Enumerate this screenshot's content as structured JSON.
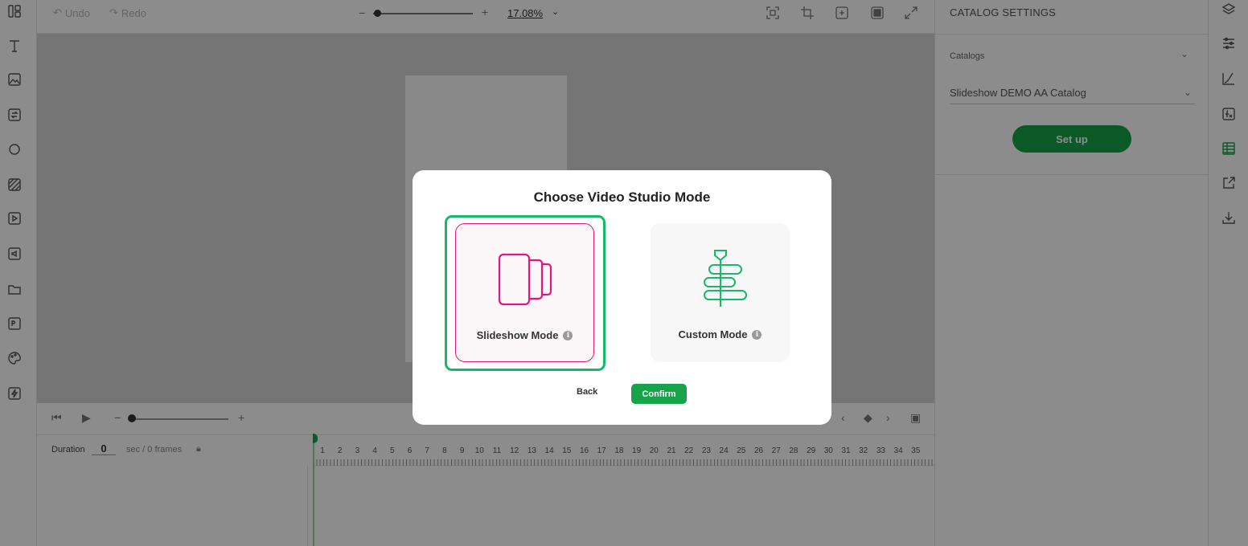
{
  "toolbar": {
    "undo_label": "Undo",
    "redo_label": "Redo",
    "zoom_minus": "−",
    "zoom_plus": "+",
    "zoom_value": "17.08%",
    "zoom_level_fraction": 0.0
  },
  "left_rail": {
    "tools": [
      "layout-icon",
      "text-icon",
      "image-icon",
      "media-swap-icon",
      "shape-icon",
      "pattern-icon",
      "video-icon",
      "audio-icon",
      "folder-icon",
      "photoshop-icon",
      "palette-icon",
      "magic-icon"
    ]
  },
  "timeline": {
    "duration_label": "Duration",
    "duration_value": "0",
    "duration_unit": "sec / 0 frames",
    "zoom_minus": "−",
    "zoom_plus": "+",
    "ruler_numbers": [
      "1",
      "2",
      "3",
      "4",
      "5",
      "6",
      "7",
      "8",
      "9",
      "10",
      "11",
      "12",
      "13",
      "14",
      "15",
      "16",
      "17",
      "18",
      "19",
      "20",
      "21",
      "22",
      "23",
      "24",
      "25",
      "26",
      "27",
      "28",
      "29",
      "30",
      "31",
      "32",
      "33",
      "34",
      "35"
    ]
  },
  "right_panel": {
    "header": "CATALOG SETTINGS",
    "catalogs_label": "Catalogs",
    "catalog_selected": "Slideshow DEMO AA Catalog",
    "setup_label": "Set up"
  },
  "modal": {
    "title": "Choose Video Studio Mode",
    "slideshow_label": "Slideshow Mode",
    "custom_label": "Custom Mode",
    "info_glyph": "i",
    "back_label": "Back",
    "confirm_label": "Confirm",
    "selected_mode": "Slideshow Mode",
    "colors": {
      "slideshow_accent": "#e0187f",
      "custom_accent": "#16b86a",
      "confirm_bg": "#16a34a",
      "selection_ring": "#16b86a"
    }
  }
}
